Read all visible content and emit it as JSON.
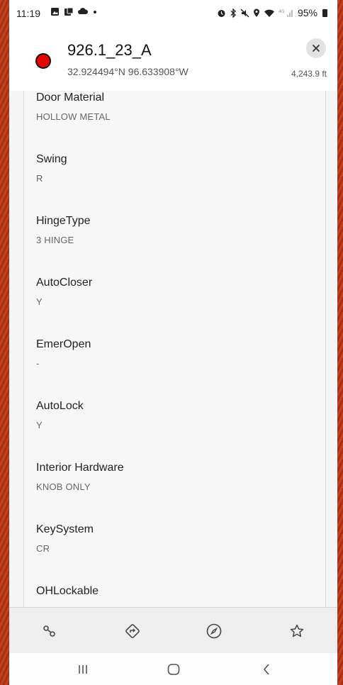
{
  "status_bar": {
    "time": "11:19",
    "left_icons": [
      "gallery-icon",
      "clipboard-icon",
      "cloud-icon",
      "notification-dot"
    ],
    "right_icons": [
      "alarm-icon",
      "bluetooth-icon",
      "mute-icon",
      "location-icon",
      "wifi-icon",
      "signal-icon"
    ],
    "battery": "95%"
  },
  "header": {
    "title": "926.1_23_A",
    "coordinates": "32.924494°N 96.633908°W",
    "distance": "4,243.9 ft",
    "close_icon": "close-icon",
    "marker_color": "#e10600"
  },
  "attributes": [
    {
      "label": "Door Material",
      "value": "HOLLOW METAL"
    },
    {
      "label": "Swing",
      "value": "R"
    },
    {
      "label": "HingeType",
      "value": "3 HINGE"
    },
    {
      "label": "AutoCloser",
      "value": "Y"
    },
    {
      "label": "EmerOpen",
      "value": "-"
    },
    {
      "label": "AutoLock",
      "value": "Y"
    },
    {
      "label": "Interior Hardware",
      "value": "KNOB ONLY"
    },
    {
      "label": "KeySystem",
      "value": "CR"
    },
    {
      "label": "OHLockable",
      "value": ""
    }
  ],
  "bottom_actions": [
    "measure-icon",
    "directions-icon",
    "compass-icon",
    "favorite-star-icon"
  ],
  "nav_bar": [
    "recent-apps-icon",
    "home-icon",
    "back-icon"
  ]
}
